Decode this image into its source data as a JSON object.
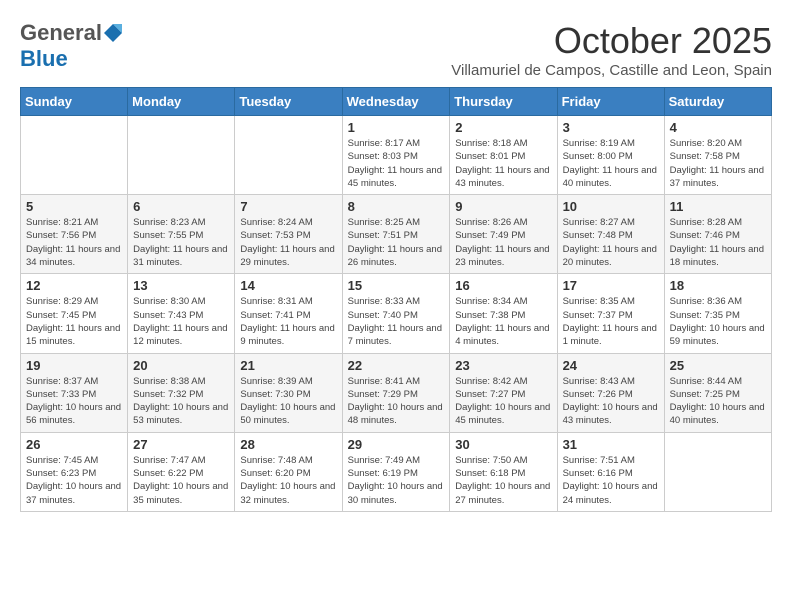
{
  "logo": {
    "general": "General",
    "blue": "Blue"
  },
  "title": "October 2025",
  "subtitle": "Villamuriel de Campos, Castille and Leon, Spain",
  "days_of_week": [
    "Sunday",
    "Monday",
    "Tuesday",
    "Wednesday",
    "Thursday",
    "Friday",
    "Saturday"
  ],
  "weeks": [
    [
      {
        "day": "",
        "info": ""
      },
      {
        "day": "",
        "info": ""
      },
      {
        "day": "",
        "info": ""
      },
      {
        "day": "1",
        "info": "Sunrise: 8:17 AM\nSunset: 8:03 PM\nDaylight: 11 hours and 45 minutes."
      },
      {
        "day": "2",
        "info": "Sunrise: 8:18 AM\nSunset: 8:01 PM\nDaylight: 11 hours and 43 minutes."
      },
      {
        "day": "3",
        "info": "Sunrise: 8:19 AM\nSunset: 8:00 PM\nDaylight: 11 hours and 40 minutes."
      },
      {
        "day": "4",
        "info": "Sunrise: 8:20 AM\nSunset: 7:58 PM\nDaylight: 11 hours and 37 minutes."
      }
    ],
    [
      {
        "day": "5",
        "info": "Sunrise: 8:21 AM\nSunset: 7:56 PM\nDaylight: 11 hours and 34 minutes."
      },
      {
        "day": "6",
        "info": "Sunrise: 8:23 AM\nSunset: 7:55 PM\nDaylight: 11 hours and 31 minutes."
      },
      {
        "day": "7",
        "info": "Sunrise: 8:24 AM\nSunset: 7:53 PM\nDaylight: 11 hours and 29 minutes."
      },
      {
        "day": "8",
        "info": "Sunrise: 8:25 AM\nSunset: 7:51 PM\nDaylight: 11 hours and 26 minutes."
      },
      {
        "day": "9",
        "info": "Sunrise: 8:26 AM\nSunset: 7:49 PM\nDaylight: 11 hours and 23 minutes."
      },
      {
        "day": "10",
        "info": "Sunrise: 8:27 AM\nSunset: 7:48 PM\nDaylight: 11 hours and 20 minutes."
      },
      {
        "day": "11",
        "info": "Sunrise: 8:28 AM\nSunset: 7:46 PM\nDaylight: 11 hours and 18 minutes."
      }
    ],
    [
      {
        "day": "12",
        "info": "Sunrise: 8:29 AM\nSunset: 7:45 PM\nDaylight: 11 hours and 15 minutes."
      },
      {
        "day": "13",
        "info": "Sunrise: 8:30 AM\nSunset: 7:43 PM\nDaylight: 11 hours and 12 minutes."
      },
      {
        "day": "14",
        "info": "Sunrise: 8:31 AM\nSunset: 7:41 PM\nDaylight: 11 hours and 9 minutes."
      },
      {
        "day": "15",
        "info": "Sunrise: 8:33 AM\nSunset: 7:40 PM\nDaylight: 11 hours and 7 minutes."
      },
      {
        "day": "16",
        "info": "Sunrise: 8:34 AM\nSunset: 7:38 PM\nDaylight: 11 hours and 4 minutes."
      },
      {
        "day": "17",
        "info": "Sunrise: 8:35 AM\nSunset: 7:37 PM\nDaylight: 11 hours and 1 minute."
      },
      {
        "day": "18",
        "info": "Sunrise: 8:36 AM\nSunset: 7:35 PM\nDaylight: 10 hours and 59 minutes."
      }
    ],
    [
      {
        "day": "19",
        "info": "Sunrise: 8:37 AM\nSunset: 7:33 PM\nDaylight: 10 hours and 56 minutes."
      },
      {
        "day": "20",
        "info": "Sunrise: 8:38 AM\nSunset: 7:32 PM\nDaylight: 10 hours and 53 minutes."
      },
      {
        "day": "21",
        "info": "Sunrise: 8:39 AM\nSunset: 7:30 PM\nDaylight: 10 hours and 50 minutes."
      },
      {
        "day": "22",
        "info": "Sunrise: 8:41 AM\nSunset: 7:29 PM\nDaylight: 10 hours and 48 minutes."
      },
      {
        "day": "23",
        "info": "Sunrise: 8:42 AM\nSunset: 7:27 PM\nDaylight: 10 hours and 45 minutes."
      },
      {
        "day": "24",
        "info": "Sunrise: 8:43 AM\nSunset: 7:26 PM\nDaylight: 10 hours and 43 minutes."
      },
      {
        "day": "25",
        "info": "Sunrise: 8:44 AM\nSunset: 7:25 PM\nDaylight: 10 hours and 40 minutes."
      }
    ],
    [
      {
        "day": "26",
        "info": "Sunrise: 7:45 AM\nSunset: 6:23 PM\nDaylight: 10 hours and 37 minutes."
      },
      {
        "day": "27",
        "info": "Sunrise: 7:47 AM\nSunset: 6:22 PM\nDaylight: 10 hours and 35 minutes."
      },
      {
        "day": "28",
        "info": "Sunrise: 7:48 AM\nSunset: 6:20 PM\nDaylight: 10 hours and 32 minutes."
      },
      {
        "day": "29",
        "info": "Sunrise: 7:49 AM\nSunset: 6:19 PM\nDaylight: 10 hours and 30 minutes."
      },
      {
        "day": "30",
        "info": "Sunrise: 7:50 AM\nSunset: 6:18 PM\nDaylight: 10 hours and 27 minutes."
      },
      {
        "day": "31",
        "info": "Sunrise: 7:51 AM\nSunset: 6:16 PM\nDaylight: 10 hours and 24 minutes."
      },
      {
        "day": "",
        "info": ""
      }
    ]
  ]
}
